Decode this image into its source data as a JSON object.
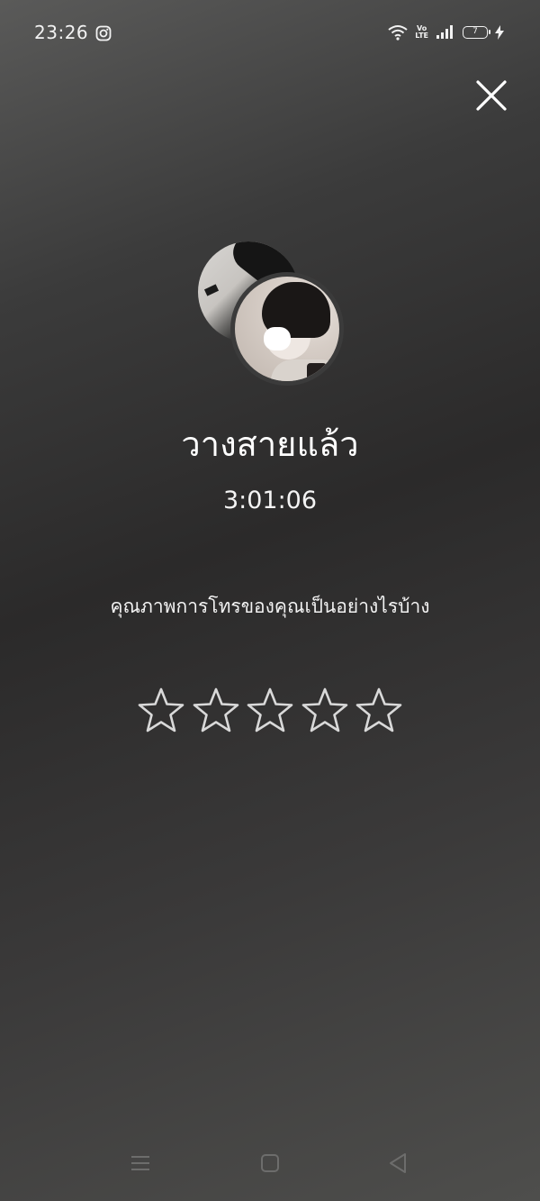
{
  "status_bar": {
    "time": "23:26",
    "volte_top": "Vo",
    "volte_bottom": "LTE",
    "battery_level": "7",
    "icons": [
      "instagram-icon",
      "wifi-icon",
      "volte-icon",
      "signal-icon",
      "battery-icon",
      "charging-icon"
    ]
  },
  "call": {
    "status": "วางสายแล้ว",
    "duration": "3:01:06"
  },
  "rating": {
    "question": "คุณภาพการโทรของคุณเป็นอย่างไรบ้าง",
    "max_stars": 5,
    "selected_stars": 0
  },
  "nav": {
    "icons": [
      "menu-icon",
      "home-icon",
      "back-icon"
    ]
  },
  "colors": {
    "text": "#ffffff",
    "star_outline": "#d9d9d9"
  }
}
